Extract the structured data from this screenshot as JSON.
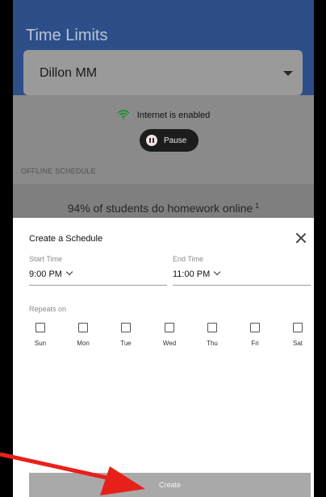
{
  "app": {
    "title": "Time Limits",
    "device_name": "Dillon MM",
    "status_text": "Internet is enabled",
    "pause_label": "Pause",
    "section_label": "OFFLINE SCHEDULE",
    "promo_text": "94% of students do homework online",
    "promo_superscript": "1"
  },
  "sheet": {
    "title": "Create a Schedule",
    "start_time_label": "Start Time",
    "start_time_value": "9:00 PM",
    "end_time_label": "End Time",
    "end_time_value": "11:00 PM",
    "repeats_label": "Repeats on",
    "days": [
      "Sun",
      "Mon",
      "Tue",
      "Wed",
      "Thu",
      "Fri",
      "Sat"
    ],
    "create_label": "Create"
  },
  "colors": {
    "header": "#2d4e88",
    "overlay": "#8a8a8a",
    "create_button": "#a9a9a9",
    "annotation_arrow": "#e8201a"
  },
  "icons": {
    "status": "wifi-icon",
    "pause": "pause-icon",
    "close": "close-icon",
    "dropdown": "chevron-down-icon"
  }
}
